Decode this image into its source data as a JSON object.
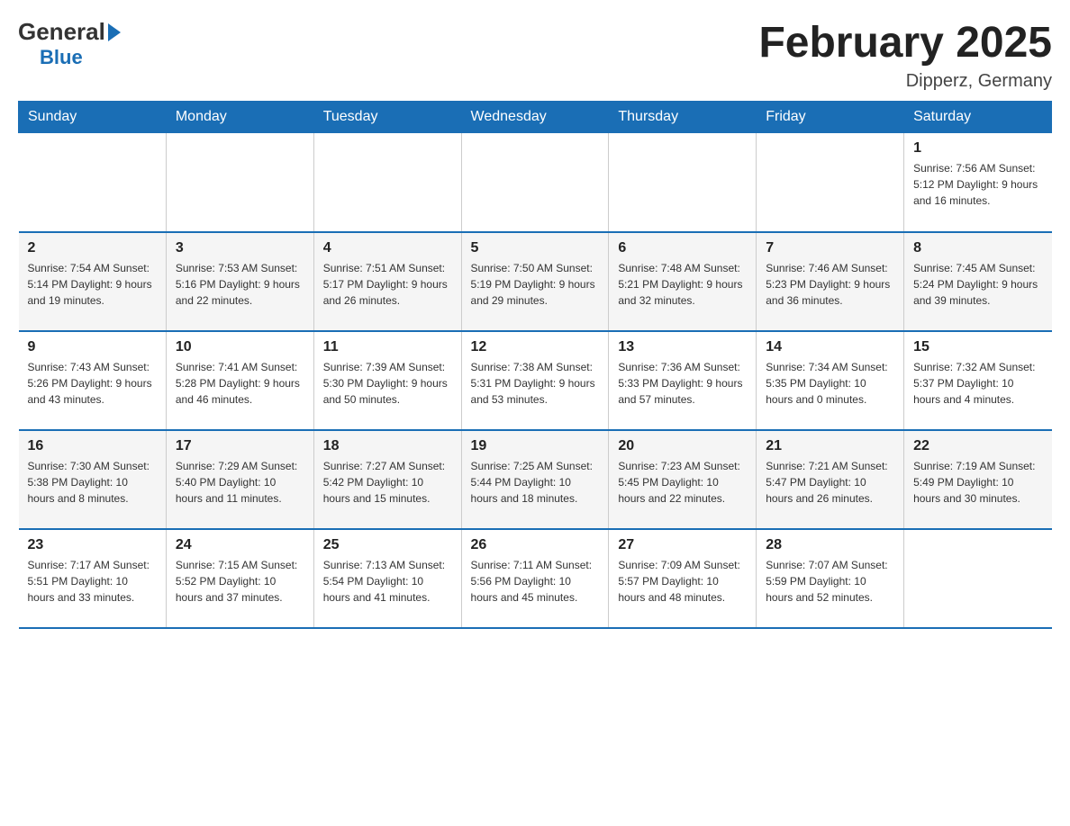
{
  "header": {
    "logo_general": "General",
    "logo_blue": "Blue",
    "month_year": "February 2025",
    "location": "Dipperz, Germany"
  },
  "weekdays": [
    "Sunday",
    "Monday",
    "Tuesday",
    "Wednesday",
    "Thursday",
    "Friday",
    "Saturday"
  ],
  "weeks": [
    {
      "days": [
        {
          "number": "",
          "info": ""
        },
        {
          "number": "",
          "info": ""
        },
        {
          "number": "",
          "info": ""
        },
        {
          "number": "",
          "info": ""
        },
        {
          "number": "",
          "info": ""
        },
        {
          "number": "",
          "info": ""
        },
        {
          "number": "1",
          "info": "Sunrise: 7:56 AM\nSunset: 5:12 PM\nDaylight: 9 hours and 16 minutes."
        }
      ]
    },
    {
      "days": [
        {
          "number": "2",
          "info": "Sunrise: 7:54 AM\nSunset: 5:14 PM\nDaylight: 9 hours and 19 minutes."
        },
        {
          "number": "3",
          "info": "Sunrise: 7:53 AM\nSunset: 5:16 PM\nDaylight: 9 hours and 22 minutes."
        },
        {
          "number": "4",
          "info": "Sunrise: 7:51 AM\nSunset: 5:17 PM\nDaylight: 9 hours and 26 minutes."
        },
        {
          "number": "5",
          "info": "Sunrise: 7:50 AM\nSunset: 5:19 PM\nDaylight: 9 hours and 29 minutes."
        },
        {
          "number": "6",
          "info": "Sunrise: 7:48 AM\nSunset: 5:21 PM\nDaylight: 9 hours and 32 minutes."
        },
        {
          "number": "7",
          "info": "Sunrise: 7:46 AM\nSunset: 5:23 PM\nDaylight: 9 hours and 36 minutes."
        },
        {
          "number": "8",
          "info": "Sunrise: 7:45 AM\nSunset: 5:24 PM\nDaylight: 9 hours and 39 minutes."
        }
      ]
    },
    {
      "days": [
        {
          "number": "9",
          "info": "Sunrise: 7:43 AM\nSunset: 5:26 PM\nDaylight: 9 hours and 43 minutes."
        },
        {
          "number": "10",
          "info": "Sunrise: 7:41 AM\nSunset: 5:28 PM\nDaylight: 9 hours and 46 minutes."
        },
        {
          "number": "11",
          "info": "Sunrise: 7:39 AM\nSunset: 5:30 PM\nDaylight: 9 hours and 50 minutes."
        },
        {
          "number": "12",
          "info": "Sunrise: 7:38 AM\nSunset: 5:31 PM\nDaylight: 9 hours and 53 minutes."
        },
        {
          "number": "13",
          "info": "Sunrise: 7:36 AM\nSunset: 5:33 PM\nDaylight: 9 hours and 57 minutes."
        },
        {
          "number": "14",
          "info": "Sunrise: 7:34 AM\nSunset: 5:35 PM\nDaylight: 10 hours and 0 minutes."
        },
        {
          "number": "15",
          "info": "Sunrise: 7:32 AM\nSunset: 5:37 PM\nDaylight: 10 hours and 4 minutes."
        }
      ]
    },
    {
      "days": [
        {
          "number": "16",
          "info": "Sunrise: 7:30 AM\nSunset: 5:38 PM\nDaylight: 10 hours and 8 minutes."
        },
        {
          "number": "17",
          "info": "Sunrise: 7:29 AM\nSunset: 5:40 PM\nDaylight: 10 hours and 11 minutes."
        },
        {
          "number": "18",
          "info": "Sunrise: 7:27 AM\nSunset: 5:42 PM\nDaylight: 10 hours and 15 minutes."
        },
        {
          "number": "19",
          "info": "Sunrise: 7:25 AM\nSunset: 5:44 PM\nDaylight: 10 hours and 18 minutes."
        },
        {
          "number": "20",
          "info": "Sunrise: 7:23 AM\nSunset: 5:45 PM\nDaylight: 10 hours and 22 minutes."
        },
        {
          "number": "21",
          "info": "Sunrise: 7:21 AM\nSunset: 5:47 PM\nDaylight: 10 hours and 26 minutes."
        },
        {
          "number": "22",
          "info": "Sunrise: 7:19 AM\nSunset: 5:49 PM\nDaylight: 10 hours and 30 minutes."
        }
      ]
    },
    {
      "days": [
        {
          "number": "23",
          "info": "Sunrise: 7:17 AM\nSunset: 5:51 PM\nDaylight: 10 hours and 33 minutes."
        },
        {
          "number": "24",
          "info": "Sunrise: 7:15 AM\nSunset: 5:52 PM\nDaylight: 10 hours and 37 minutes."
        },
        {
          "number": "25",
          "info": "Sunrise: 7:13 AM\nSunset: 5:54 PM\nDaylight: 10 hours and 41 minutes."
        },
        {
          "number": "26",
          "info": "Sunrise: 7:11 AM\nSunset: 5:56 PM\nDaylight: 10 hours and 45 minutes."
        },
        {
          "number": "27",
          "info": "Sunrise: 7:09 AM\nSunset: 5:57 PM\nDaylight: 10 hours and 48 minutes."
        },
        {
          "number": "28",
          "info": "Sunrise: 7:07 AM\nSunset: 5:59 PM\nDaylight: 10 hours and 52 minutes."
        },
        {
          "number": "",
          "info": ""
        }
      ]
    }
  ]
}
